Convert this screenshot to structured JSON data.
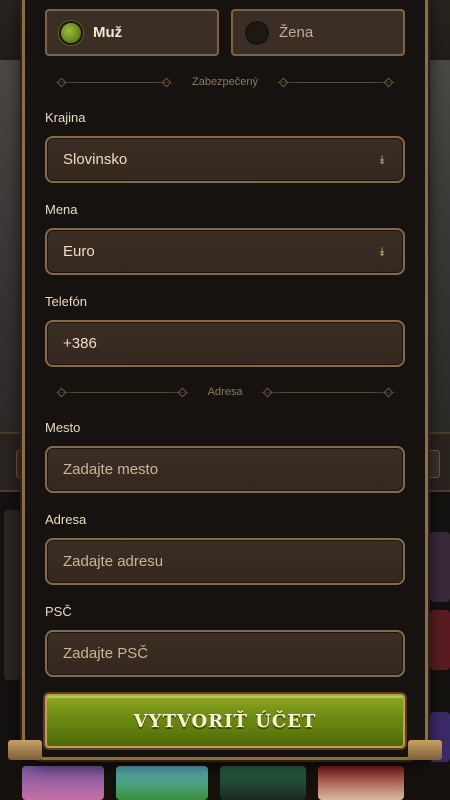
{
  "gender": {
    "male_label": "Muž",
    "female_label": "Žena",
    "selected": "male"
  },
  "sections": {
    "security": "Zabezpečený",
    "address": "Adresa"
  },
  "fields": {
    "country": {
      "label": "Krajina",
      "value": "Slovinsko"
    },
    "currency": {
      "label": "Mena",
      "value": "Euro"
    },
    "phone": {
      "label": "Telefón",
      "value": "+386"
    },
    "city": {
      "label": "Mesto",
      "placeholder": "Zadajte mesto"
    },
    "address": {
      "label": "Adresa",
      "placeholder": "Zadajte adresu"
    },
    "zip": {
      "label": "PSČ",
      "placeholder": "Zadajte PSČ"
    }
  },
  "submit_label": "VYTVORIŤ ÚČET",
  "icons": {
    "select_chevron": "chevron-down-icon"
  },
  "colors": {
    "accent_green": "#6b8a12",
    "frame_gold": "#8e6d45",
    "field_bg": "#3b2e24"
  }
}
